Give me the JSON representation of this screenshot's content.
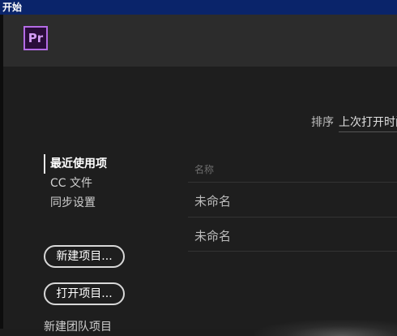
{
  "window": {
    "title": "开始"
  },
  "header": {
    "logo_text": "Pr",
    "logo_icon": "premiere-pro-logo-icon"
  },
  "sort": {
    "label": "排序",
    "value": "上次打开时间"
  },
  "nav": {
    "items": [
      {
        "label": "最近使用项",
        "active": true
      },
      {
        "label": "CC 文件",
        "active": false
      },
      {
        "label": "同步设置",
        "active": false
      }
    ]
  },
  "buttons": {
    "new_project": "新建项目...",
    "open_project": "打开项目...",
    "new_team_project": "新建团队项目"
  },
  "list": {
    "column_name": "名称",
    "rows": [
      {
        "name": "未命名"
      },
      {
        "name": "未命名"
      }
    ]
  },
  "colors": {
    "title_bar": "#0a246a",
    "logo_accent": "#b46be6",
    "background": "#1e1e1e"
  }
}
